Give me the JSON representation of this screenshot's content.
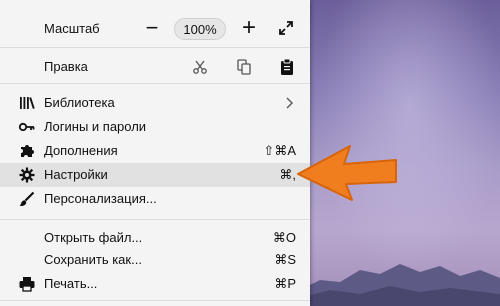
{
  "menu": {
    "zoom": {
      "label": "Масштаб",
      "minus": "−",
      "value": "100%",
      "plus": "+"
    },
    "edit": {
      "label": "Правка"
    },
    "items": [
      {
        "label": "Библиотека",
        "icon": "library-icon",
        "submenu": true
      },
      {
        "label": "Логины и пароли",
        "icon": "key-icon"
      },
      {
        "label": "Дополнения",
        "icon": "puzzle-icon",
        "shortcut": "⇧⌘A"
      },
      {
        "label": "Настройки",
        "icon": "gear-icon",
        "shortcut": "⌘,",
        "highlighted": true
      },
      {
        "label": "Персонализация...",
        "icon": "brush-icon"
      }
    ],
    "file_items": [
      {
        "label": "Открыть файл...",
        "shortcut": "⌘O"
      },
      {
        "label": "Сохранить как...",
        "shortcut": "⌘S"
      },
      {
        "label": "Печать...",
        "icon": "printer-icon",
        "shortcut": "⌘P"
      }
    ]
  },
  "colors": {
    "arrow": "#f07d1e",
    "highlight": "#e1e1e1",
    "menu_bg": "#f4f4f4"
  }
}
